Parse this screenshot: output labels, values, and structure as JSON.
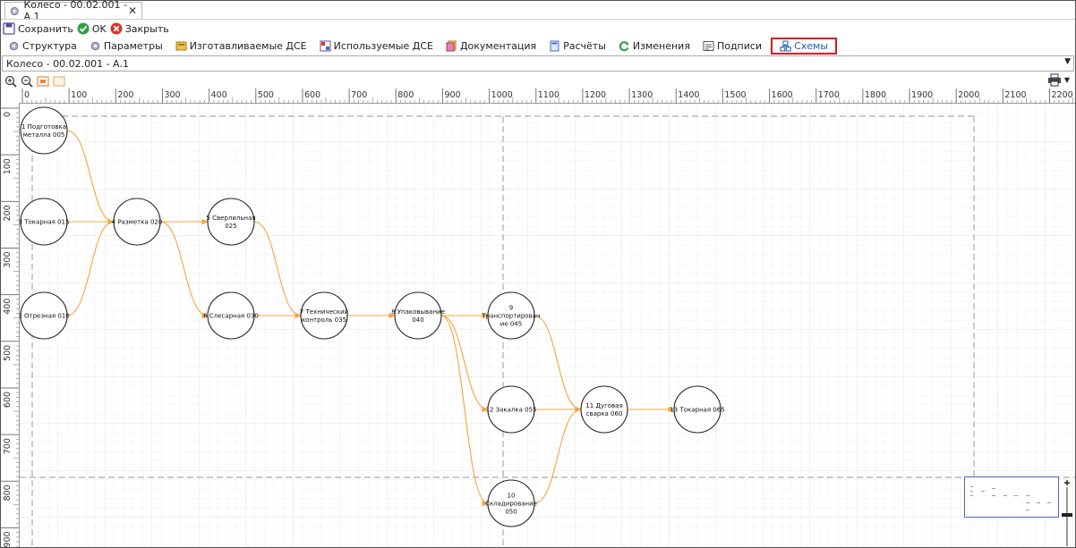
{
  "window": {
    "tab_title": "Колесо - 00.02.001 - А.1"
  },
  "toolbar": {
    "save_label": "Сохранить",
    "ok_label": "OK",
    "close_label": "Закрыть"
  },
  "tabs": [
    {
      "label": "Структура"
    },
    {
      "label": "Параметры"
    },
    {
      "label": "Изготавливаемые ДСЕ"
    },
    {
      "label": "Используемые ДСЕ"
    },
    {
      "label": "Документация"
    },
    {
      "label": "Расчёты"
    },
    {
      "label": "Изменения"
    },
    {
      "label": "Подписи"
    },
    {
      "label": "Схемы"
    }
  ],
  "path": {
    "value": "Колесо - 00.02.001 - А.1"
  },
  "ruler": {
    "h_ticks": [
      "0",
      "100",
      "200",
      "300",
      "400",
      "500",
      "600",
      "700",
      "800",
      "900",
      "1000",
      "1100",
      "1200",
      "1300",
      "1400",
      "1500",
      "1600",
      "1700",
      "1800",
      "1900",
      "2000",
      "2100",
      "2200"
    ],
    "v_ticks": [
      "0",
      "100",
      "200",
      "300",
      "400",
      "500",
      "600",
      "700",
      "800",
      "900"
    ]
  },
  "colors": {
    "edge": "#f5a440",
    "accent": "#1f5fb3",
    "highlight": "#e0141e"
  },
  "nodes": [
    {
      "id": "n1",
      "lines": [
        "1 Подготовка",
        "металла 005"
      ]
    },
    {
      "id": "n3",
      "lines": [
        "3 Токарная 015"
      ]
    },
    {
      "id": "n2",
      "lines": [
        "2 Отрезная 010"
      ]
    },
    {
      "id": "n4",
      "lines": [
        "4 Разметка 020"
      ]
    },
    {
      "id": "n5",
      "lines": [
        "5 Сверлильная",
        "025"
      ]
    },
    {
      "id": "n6",
      "lines": [
        "6 Слесарная 030"
      ]
    },
    {
      "id": "n7",
      "lines": [
        "7 Технический",
        "контроль 035"
      ]
    },
    {
      "id": "n8",
      "lines": [
        "8 Упаковывание",
        "040"
      ]
    },
    {
      "id": "n9",
      "lines": [
        "9",
        "Транспортирован",
        "ие 045"
      ]
    },
    {
      "id": "n12",
      "lines": [
        "12 Закалка 055"
      ]
    },
    {
      "id": "n10",
      "lines": [
        "10",
        "Складирование",
        "050"
      ]
    },
    {
      "id": "n11",
      "lines": [
        "11 Дуговая",
        "сварка 060"
      ]
    },
    {
      "id": "n13",
      "lines": [
        "13 Токарная 065"
      ]
    }
  ],
  "edges": [
    [
      "n1",
      "n4"
    ],
    [
      "n3",
      "n4"
    ],
    [
      "n2",
      "n4"
    ],
    [
      "n4",
      "n5"
    ],
    [
      "n4",
      "n6"
    ],
    [
      "n5",
      "n7"
    ],
    [
      "n6",
      "n7"
    ],
    [
      "n7",
      "n8"
    ],
    [
      "n8",
      "n9"
    ],
    [
      "n8",
      "n12"
    ],
    [
      "n8",
      "n10"
    ],
    [
      "n9",
      "n11"
    ],
    [
      "n12",
      "n11"
    ],
    [
      "n10",
      "n11"
    ],
    [
      "n11",
      "n13"
    ]
  ]
}
